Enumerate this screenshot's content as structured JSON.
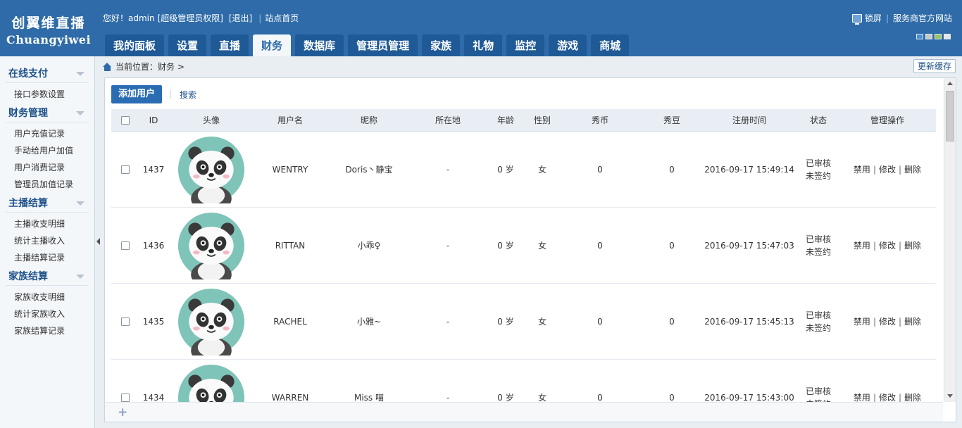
{
  "logo": {
    "cn": "创翼维直播",
    "en": "Chuangyiwei"
  },
  "userbar": {
    "greeting": "您好！admin",
    "role": "[超级管理员权限]",
    "logout": "[退出]",
    "home": "站点首页"
  },
  "topright": {
    "lock": "锁屏",
    "provider": "服务商官方网站"
  },
  "skins": [
    "#4b8fd1",
    "#c8c8c8",
    "#9bc45a",
    "#e6e6e6"
  ],
  "nav": [
    "我的面板",
    "设置",
    "直播",
    "财务",
    "数据库",
    "管理员管理",
    "家族",
    "礼物",
    "监控",
    "游戏",
    "商城"
  ],
  "nav_active": "财务",
  "sidebar": [
    {
      "title": "在线支付",
      "items": [
        "接口参数设置"
      ]
    },
    {
      "title": "财务管理",
      "items": [
        "用户充值记录",
        "手动给用户加值",
        "用户消费记录",
        "管理员加值记录"
      ]
    },
    {
      "title": "主播结算",
      "items": [
        "主播收支明细",
        "统计主播收入",
        "主播结算记录"
      ]
    },
    {
      "title": "家族结算",
      "items": [
        "家族收支明细",
        "统计家族收入",
        "家族结算记录"
      ]
    }
  ],
  "breadcrumb": {
    "label": "当前位置：",
    "path": "财务 >"
  },
  "refresh": "更新缓存",
  "toolbar": {
    "add_user": "添加用户",
    "search": "搜索"
  },
  "table": {
    "headers": [
      "ID",
      "头像",
      "用户名",
      "昵称",
      "所在地",
      "年龄",
      "性别",
      "秀币",
      "秀豆",
      "注册时间",
      "状态",
      "管理操作"
    ],
    "rows": [
      {
        "id": "1437",
        "username": "WENTRY",
        "nickname": "Doris丶静宝",
        "location": "-",
        "age": "0 岁",
        "gender": "女",
        "coins": "0",
        "beans": "0",
        "reg_time": "2016-09-17 15:49:14",
        "status1": "已审核",
        "status2": "未签约"
      },
      {
        "id": "1436",
        "username": "RITTAN",
        "nickname": "小乖♀",
        "location": "-",
        "age": "0 岁",
        "gender": "女",
        "coins": "0",
        "beans": "0",
        "reg_time": "2016-09-17 15:47:03",
        "status1": "已审核",
        "status2": "未签约"
      },
      {
        "id": "1435",
        "username": "RACHEL",
        "nickname": "小雅~",
        "location": "-",
        "age": "0 岁",
        "gender": "女",
        "coins": "0",
        "beans": "0",
        "reg_time": "2016-09-17 15:45:13",
        "status1": "已审核",
        "status2": "未签约"
      },
      {
        "id": "1434",
        "username": "WARREN",
        "nickname": "Miss 喵",
        "location": "-",
        "age": "0 岁",
        "gender": "女",
        "coins": "0",
        "beans": "0",
        "reg_time": "2016-09-17 15:43:00",
        "status1": "已审核",
        "status2": "未签约"
      }
    ],
    "actions": [
      "禁用",
      "修改",
      "删除"
    ]
  },
  "colors": {
    "header_bg": "#2e6ba8",
    "tab_bg": "#1f5a96",
    "accent": "#2b6db3",
    "avatar_bg": "#7fc4b8"
  },
  "icons": [
    "lock-icon",
    "home-icon",
    "collapse-arrow-icon",
    "add-row-icon",
    "panda-avatar"
  ]
}
